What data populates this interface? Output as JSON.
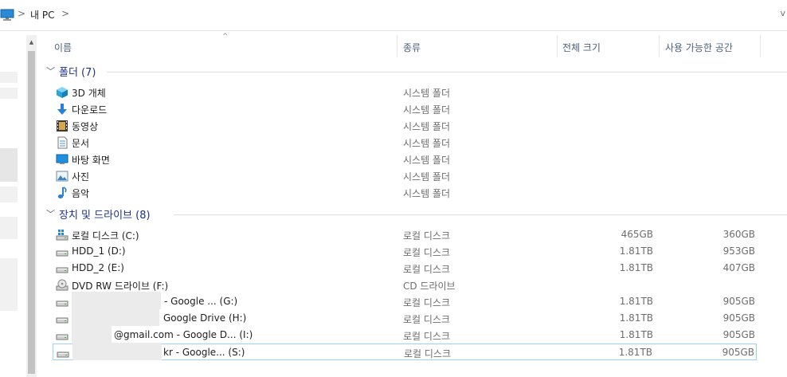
{
  "address": {
    "root_icon": "computer-icon",
    "crumb": "내 PC",
    "separator": ">",
    "dropdown": "v"
  },
  "columns": {
    "name": "이름",
    "type": "종류",
    "total": "전체 크기",
    "free": "사용 가능한 공간",
    "sort_indicator": "^"
  },
  "groups": {
    "folders": {
      "label": "폴더 (7)",
      "items": [
        {
          "name": "3D 개체",
          "type": "시스템 폴더",
          "icon": "3d-objects-icon"
        },
        {
          "name": "다운로드",
          "type": "시스템 폴더",
          "icon": "download-arrow-icon"
        },
        {
          "name": "동영상",
          "type": "시스템 폴더",
          "icon": "video-film-icon"
        },
        {
          "name": "문서",
          "type": "시스템 폴더",
          "icon": "document-icon"
        },
        {
          "name": "바탕 화면",
          "type": "시스템 폴더",
          "icon": "desktop-icon"
        },
        {
          "name": "사진",
          "type": "시스템 폴더",
          "icon": "pictures-icon"
        },
        {
          "name": "음악",
          "type": "시스템 폴더",
          "icon": "music-note-icon"
        }
      ]
    },
    "drives": {
      "label": "장치 및 드라이브 (8)",
      "items": [
        {
          "name": "로컬 디스크 (C:)",
          "type": "로컬 디스크",
          "total": "465GB",
          "free": "360GB",
          "icon": "windows-drive-icon"
        },
        {
          "name": "HDD_1 (D:)",
          "type": "로컬 디스크",
          "total": "1.81TB",
          "free": "953GB",
          "icon": "hard-drive-icon"
        },
        {
          "name": "HDD_2 (E:)",
          "type": "로컬 디스크",
          "total": "1.81TB",
          "free": "407GB",
          "icon": "hard-drive-icon"
        },
        {
          "name": "DVD RW 드라이브 (F:)",
          "type": "CD 드라이브",
          "total": "",
          "free": "",
          "icon": "dvd-drive-icon"
        },
        {
          "name": "- Google ... (G:)",
          "type": "로컬 디스크",
          "total": "1.81TB",
          "free": "905GB",
          "icon": "hard-drive-icon"
        },
        {
          "name": "Google Drive (H:)",
          "type": "로컬 디스크",
          "total": "1.81TB",
          "free": "905GB",
          "icon": "hard-drive-icon"
        },
        {
          "name": "@gmail.com - Google D... (I:)",
          "type": "로컬 디스크",
          "total": "1.81TB",
          "free": "905GB",
          "icon": "hard-drive-icon"
        },
        {
          "name": "kr - Google... (S:)",
          "type": "로컬 디스크",
          "total": "1.81TB",
          "free": "905GB",
          "icon": "hard-drive-icon"
        }
      ]
    }
  },
  "colors": {
    "group_label": "#1e3287",
    "header_text": "#4c607a",
    "selection_border": "#99d1ff"
  }
}
